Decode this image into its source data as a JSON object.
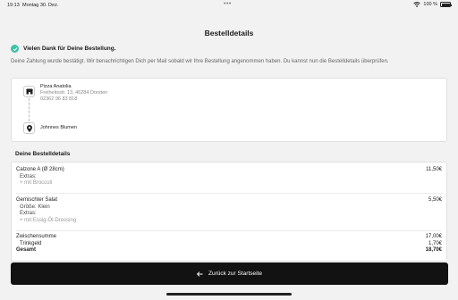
{
  "status_bar": {
    "time": "19:13",
    "date": "Montag 30. Dez.",
    "dots": "•••",
    "battery": "100 %"
  },
  "page": {
    "title": "Bestelldetails",
    "thanks": "Vielen Dank für Deine Bestellung.",
    "info": "Deine Zahlung wurde bestätigt. Wir benachrichtigen Dich per Mail sobald wir Ihre Bestellung angenommen haben. Du kannst nun die Bestelldetails überprüfen."
  },
  "route": {
    "restaurant_name": "Pizza Anatolia",
    "restaurant_address": "Freiheitsstr. 13, 46284 Dorsten",
    "restaurant_phone": "02362 96 83 818",
    "customer_name": "Johnnes Blumen"
  },
  "order": {
    "section_title": "Deine Bestelldetails",
    "items": [
      {
        "name": "Calzone A (Ø 28cm)",
        "price": "11,50€",
        "extras_label": "Extras:",
        "extras": "+ mit Broccoli"
      },
      {
        "name": "Gemischter Salat",
        "price": "5,50€",
        "size_label": "Größe: Klein",
        "extras_label": "Extras:",
        "extras": "+ mit Essig-Öl-Dressing"
      }
    ],
    "subtotal_label": "Zwischensumme",
    "subtotal": "17,00€",
    "tip_label": "Trinkgeld",
    "tip": "1,70€",
    "total_label": "Gesamt",
    "total": "18,70€"
  },
  "footer": {
    "back_label": "Zurück zur Startseite"
  },
  "colors": {
    "accent_check": "#3cc3a4",
    "button_bg": "#121212",
    "page_bg": "#f2f2f2"
  }
}
